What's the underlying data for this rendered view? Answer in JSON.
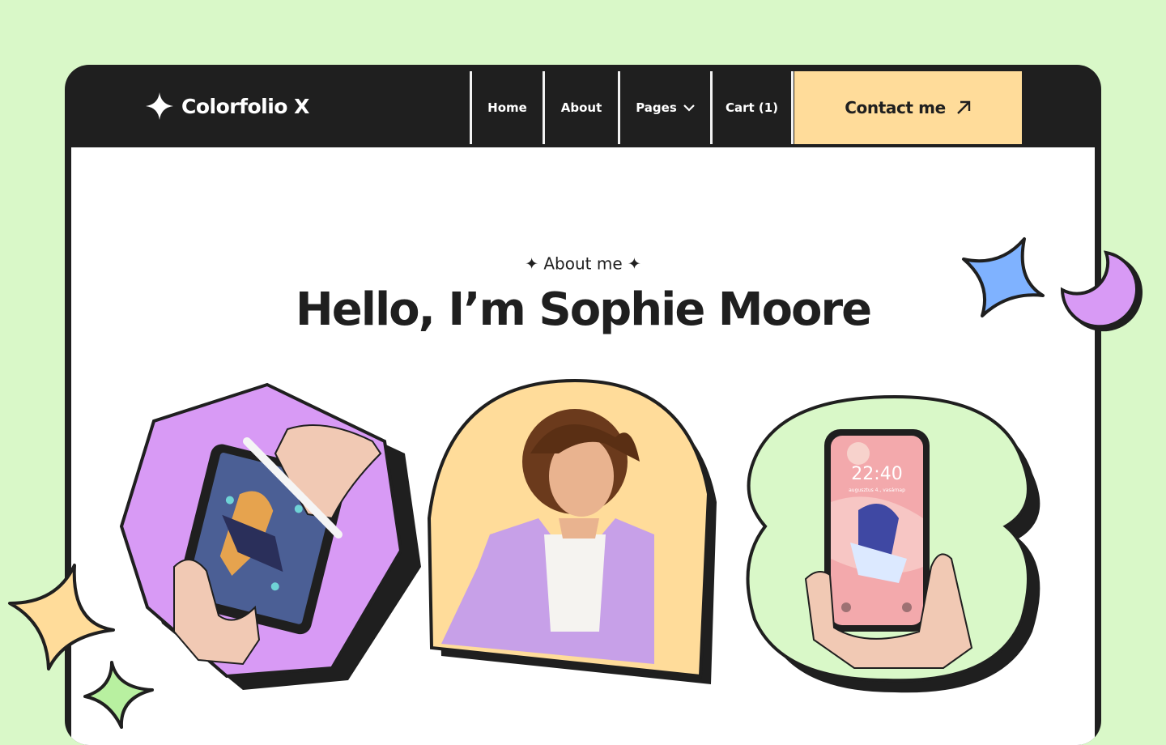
{
  "brand": {
    "name": "Colorfolio X",
    "logo_icon": "sparkle-icon"
  },
  "nav": {
    "items": [
      {
        "label": "Home"
      },
      {
        "label": "About"
      },
      {
        "label": "Pages",
        "icon": "chevron-down-icon"
      },
      {
        "label": "Cart (1)"
      }
    ],
    "cta_label": "Contact me",
    "cta_icon": "arrow-up-right-icon"
  },
  "hero": {
    "eyebrow": "About me",
    "title": "Hello, I’m Sophie Moore"
  },
  "images": [
    {
      "name": "hands-with-tablet-image",
      "bg": "#d89af5"
    },
    {
      "name": "sophie-portrait-image",
      "bg": "#ffdc9a"
    },
    {
      "name": "hand-with-phone-image",
      "bg": "#d9f8c8",
      "phone_time": "22:40",
      "phone_date": "augusztus 4., vasárnap"
    }
  ],
  "colors": {
    "background": "#d9f8c8",
    "frame": "#1f1f1f",
    "accent_yellow": "#ffdc9a",
    "accent_purple": "#d89af5",
    "accent_blue": "#7fb2ff",
    "accent_green": "#b8f0a0"
  }
}
